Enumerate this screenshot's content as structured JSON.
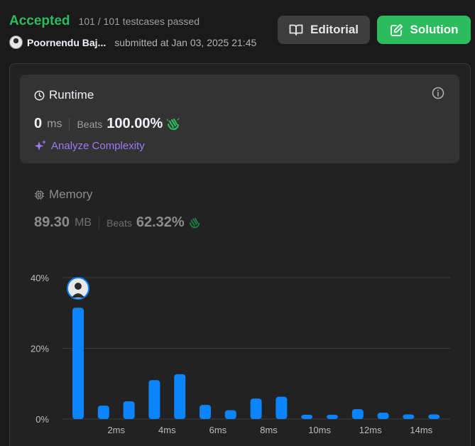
{
  "header": {
    "status": "Accepted",
    "testcases": "101 / 101 testcases passed",
    "username": "Poornendu Baj...",
    "submitted": "submitted at Jan 03, 2025 21:45",
    "editorial_label": "Editorial",
    "solution_label": "Solution"
  },
  "runtime": {
    "title": "Runtime",
    "value": "0",
    "unit": "ms",
    "beats_label": "Beats",
    "beats_value": "100.00%",
    "analyze_label": "Analyze Complexity"
  },
  "memory": {
    "title": "Memory",
    "value": "89.30",
    "unit": "MB",
    "beats_label": "Beats",
    "beats_value": "62.32%"
  },
  "colors": {
    "accent_green": "#2cbb5d",
    "bar_blue": "#0a84ff",
    "analyze_purple": "#9b7bf5"
  },
  "chart_data": {
    "type": "bar",
    "title": "",
    "xlabel": "",
    "ylabel": "",
    "y_ticks": [
      "40%",
      "20%",
      "0%"
    ],
    "x_ticks": [
      "2ms",
      "4ms",
      "6ms",
      "8ms",
      "10ms",
      "12ms",
      "14ms"
    ],
    "ylim": [
      0,
      40
    ],
    "grid": true,
    "values": [
      31.5,
      3.8,
      5.0,
      11.0,
      12.7,
      4.0,
      2.5,
      5.8,
      6.3,
      1.2,
      1.2,
      2.8,
      1.8,
      1.3,
      1.3
    ],
    "highlight_index": 0
  }
}
